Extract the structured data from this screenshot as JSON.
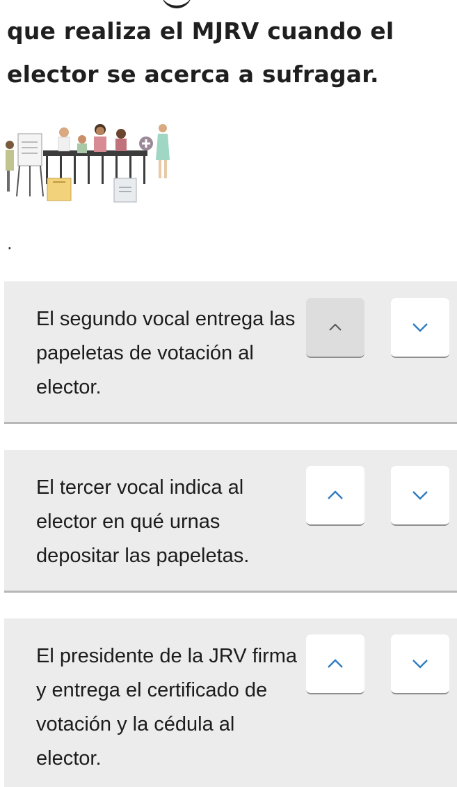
{
  "question": {
    "text": "que realiza el MJRV cuando el elector se acerca a sufragar."
  },
  "separator_text": ".",
  "items": [
    {
      "text": "El segundo vocal entrega las papeletas de votación al elector.",
      "up_icon": "chevron-up-icon",
      "down_icon": "chevron-down-icon",
      "up_state": "disabled",
      "down_state": "enabled"
    },
    {
      "text": "El tercer vocal indica al elector en qué urnas depositar las papeletas.",
      "up_icon": "chevron-up-icon",
      "down_icon": "chevron-down-icon",
      "up_state": "enabled",
      "down_state": "enabled"
    },
    {
      "text": "El presidente de la JRV firma y entrega el certificado de votación y la cédula al elector.",
      "up_icon": "chevron-up-icon",
      "down_icon": "chevron-down-icon",
      "up_state": "enabled",
      "down_state": "enabled"
    }
  ],
  "colors": {
    "card_background": "#ececec",
    "card_border": "#b7b7b7",
    "chevron_enabled": "#2e7cc0",
    "chevron_disabled": "#555555",
    "button_disabled": "#dddddd",
    "button_enabled": "#ffffff"
  }
}
